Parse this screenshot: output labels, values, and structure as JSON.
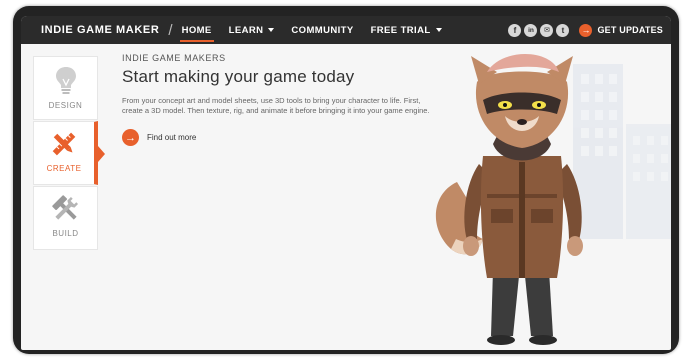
{
  "nav": {
    "brand": "INDIE GAME MAKER",
    "separator": "/",
    "items": [
      {
        "label": "HOME",
        "active": true,
        "dropdown": false
      },
      {
        "label": "LEARN",
        "active": false,
        "dropdown": true
      },
      {
        "label": "COMMUNITY",
        "active": false,
        "dropdown": false
      },
      {
        "label": "FREE TRIAL",
        "active": false,
        "dropdown": true
      }
    ],
    "social": [
      {
        "icon": "facebook-icon",
        "glyph": "f"
      },
      {
        "icon": "linkedin-icon",
        "glyph": "in"
      },
      {
        "icon": "email-icon",
        "glyph": "✉"
      },
      {
        "icon": "twitter-icon",
        "glyph": "t"
      }
    ],
    "updates_label": "GET UPDATES",
    "updates_icon": "arrow-right-icon"
  },
  "sidebar": {
    "items": [
      {
        "label": "DESIGN",
        "icon": "lightbulb-icon",
        "active": false
      },
      {
        "label": "CREATE",
        "icon": "pencil-ruler-icon",
        "active": true
      },
      {
        "label": "BUILD",
        "icon": "hammer-wrench-icon",
        "active": false
      }
    ]
  },
  "content": {
    "eyebrow": "INDIE GAME MAKERS",
    "headline": "Start making your game today",
    "description": "From your concept art and model sheets, use 3D tools to bring your character to life. First, create a 3D model. Then texture, rig, and animate it before bringing it into your game engine.",
    "cta_label": "Find out more",
    "cta_icon": "arrow-right-icon"
  },
  "colors": {
    "accent": "#e8602c",
    "navbar": "#2b2b2b",
    "background": "#f6f6f6"
  }
}
